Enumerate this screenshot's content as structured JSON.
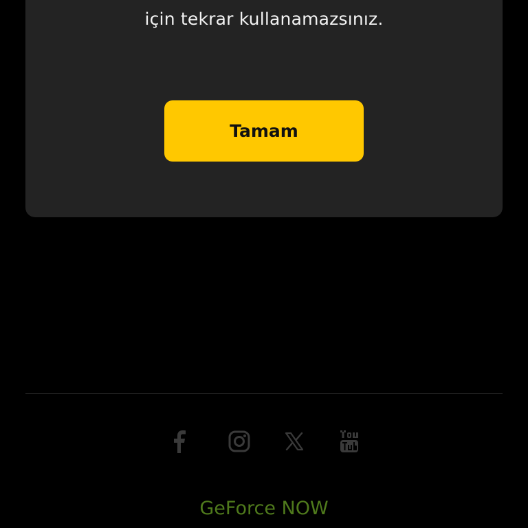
{
  "dialog": {
    "message_tail": "için tekrar kullanamazsınız.",
    "ok_label": "Tamam"
  },
  "social": {
    "icons": [
      "facebook-icon",
      "instagram-icon",
      "x-icon",
      "youtube-icon"
    ],
    "icon_color": "#3a3a3a"
  },
  "footer": {
    "brand": "GeForce NOW",
    "brand_color": "#4f7a1c"
  },
  "colors": {
    "background": "#000000",
    "card": "#232323",
    "accent": "#ffc800"
  }
}
